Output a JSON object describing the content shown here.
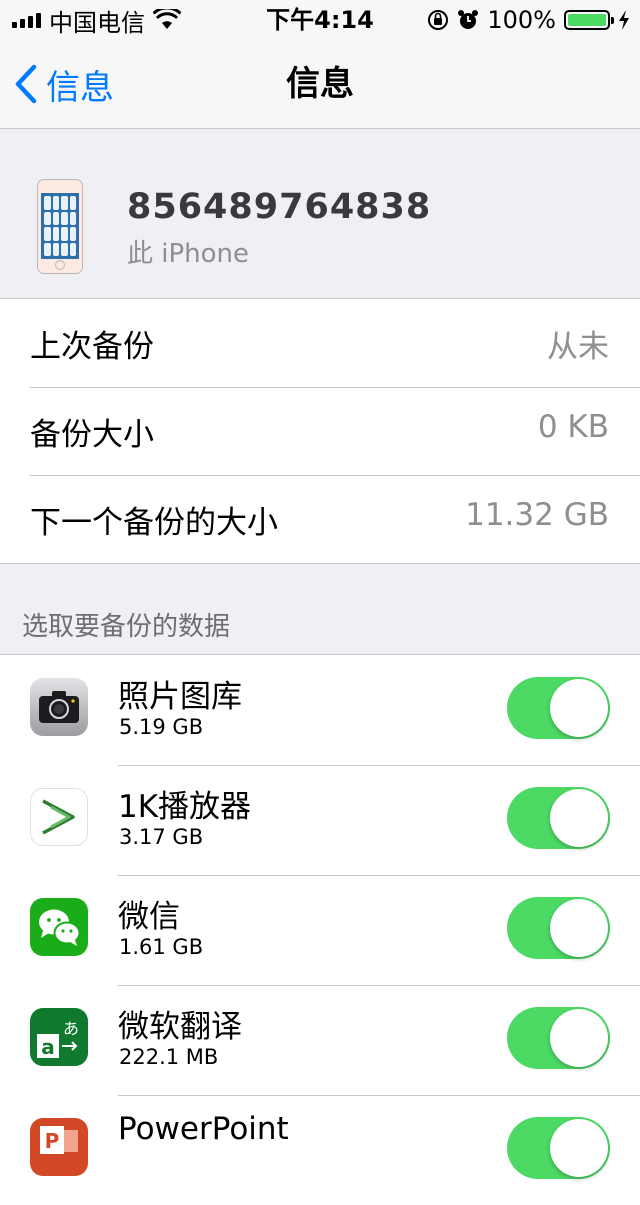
{
  "status_bar": {
    "carrier": "中国电信",
    "time": "下午4:14",
    "battery": "100%",
    "battery_level": 1.0
  },
  "nav": {
    "back_label": "信息",
    "title": "信息"
  },
  "device": {
    "number": "856489764838",
    "subtitle": "此 iPhone"
  },
  "info_rows": [
    {
      "label": "上次备份",
      "value": "从未"
    },
    {
      "label": "备份大小",
      "value": "0 KB"
    },
    {
      "label": "下一个备份的大小",
      "value": "11.32 GB"
    }
  ],
  "section_header": "选取要备份的数据",
  "apps": [
    {
      "name": "照片图库",
      "size": "5.19 GB",
      "icon": "camera-icon",
      "enabled": true
    },
    {
      "name": "1K播放器",
      "size": "3.17 GB",
      "icon": "player-icon",
      "enabled": true
    },
    {
      "name": "微信",
      "size": "1.61 GB",
      "icon": "wechat-icon",
      "enabled": true
    },
    {
      "name": "微软翻译",
      "size": "222.1 MB",
      "icon": "translator-icon",
      "enabled": true
    },
    {
      "name": "PowerPoint",
      "size": "",
      "icon": "powerpoint-icon",
      "enabled": true
    }
  ],
  "colors": {
    "accent": "#007aff",
    "toggle_on": "#4cd964",
    "background": "#efeff4"
  }
}
